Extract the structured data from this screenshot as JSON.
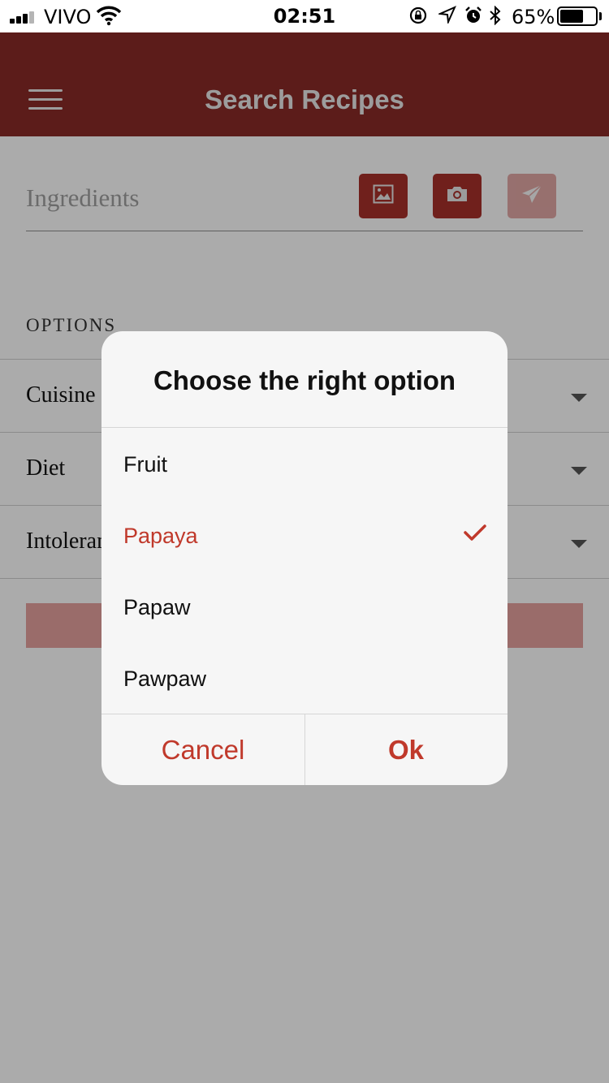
{
  "status_bar": {
    "carrier": "VIVO",
    "time": "02:51",
    "battery_percent": "65%",
    "battery_level": 0.65,
    "icons": [
      "signal-icon",
      "wifi-icon",
      "orientation-lock-icon",
      "location-icon",
      "alarm-icon",
      "bluetooth-icon",
      "battery-icon"
    ]
  },
  "header": {
    "title": "Search Recipes",
    "background_color": "#8a2a27"
  },
  "search": {
    "placeholder": "Ingredients",
    "actions": [
      "image-icon",
      "camera-icon",
      "send-icon"
    ]
  },
  "options": {
    "heading": "OPTIONS",
    "rows": [
      {
        "label": "Cuisine"
      },
      {
        "label": "Diet"
      },
      {
        "label": "Intoleran"
      }
    ]
  },
  "dialog": {
    "title": "Choose the right option",
    "options": [
      {
        "label": "Fruit",
        "selected": false
      },
      {
        "label": "Papaya",
        "selected": true
      },
      {
        "label": "Papaw",
        "selected": false
      },
      {
        "label": "Pawpaw",
        "selected": false
      }
    ],
    "cancel_label": "Cancel",
    "ok_label": "Ok",
    "accent_color": "#c0392b"
  }
}
